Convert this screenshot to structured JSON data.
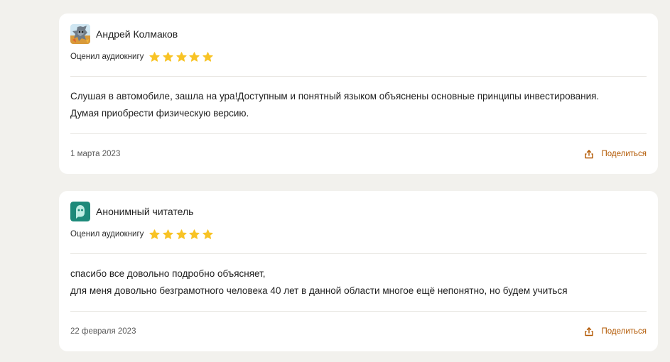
{
  "colors": {
    "page_background": "#f2f1ed",
    "card_background": "#ffffff",
    "star_fill": "#f8c325",
    "share_accent": "#b25700",
    "divider": "#e6e4df"
  },
  "reviews": [
    {
      "author": "Андрей Колмаков",
      "avatar_icon": "wolf-avatar-icon",
      "rating_label": "Оценил аудиокнигу",
      "rating": 5,
      "rating_max": 5,
      "text_lines": [
        "Слушая в автомобиле, зашла на ура!Доступным и понятный языком объяснены основные принципы инвестирования.",
        "Думая приобрести физическую версию."
      ],
      "date": "1 марта 2023",
      "share_label": "Поделиться",
      "share_icon": "share-icon"
    },
    {
      "author": "Анонимный читатель",
      "avatar_icon": "ghost-avatar-icon",
      "rating_label": "Оценил аудиокнигу",
      "rating": 5,
      "rating_max": 5,
      "text_lines": [
        "спасибо все довольно подробно объясняет,",
        "для меня довольно безграмотного человека 40 лет в данной области многое ещё непонятно, но будем учиться"
      ],
      "date": "22 февраля 2023",
      "share_label": "Поделиться",
      "share_icon": "share-icon"
    }
  ]
}
